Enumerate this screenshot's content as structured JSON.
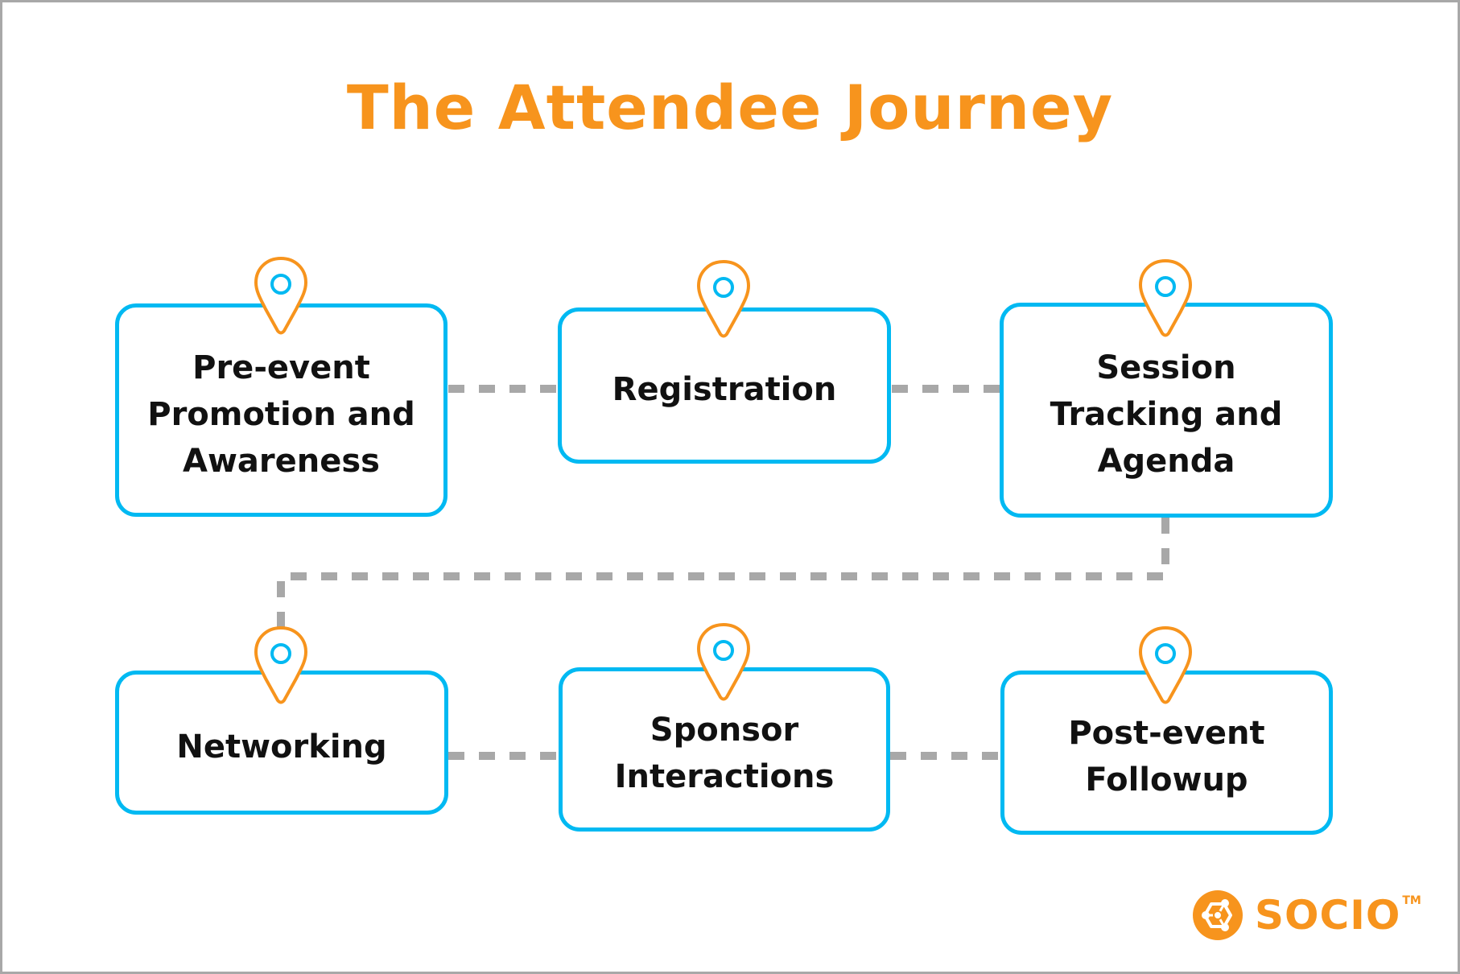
{
  "title": "The Attendee Journey",
  "colors": {
    "accent_orange": "#f7941d",
    "box_border_blue": "#00b9f2",
    "connector_gray": "#a8a8a8",
    "text_dark": "#111111"
  },
  "steps": [
    {
      "label": "Pre-event\nPromotion and\nAwareness",
      "icon": "map-pin-icon"
    },
    {
      "label": "Registration",
      "icon": "map-pin-icon"
    },
    {
      "label": "Session\nTracking and\nAgenda",
      "icon": "map-pin-icon"
    },
    {
      "label": "Networking",
      "icon": "map-pin-icon"
    },
    {
      "label": "Sponsor\nInteractions",
      "icon": "map-pin-icon"
    },
    {
      "label": "Post-event\nFollowup",
      "icon": "map-pin-icon"
    }
  ],
  "flow": [
    {
      "from": 0,
      "to": 1
    },
    {
      "from": 1,
      "to": 2
    },
    {
      "from": 2,
      "to": 3
    },
    {
      "from": 3,
      "to": 4
    },
    {
      "from": 4,
      "to": 5
    }
  ],
  "logo": {
    "icon": "socio-hexagon-logo-icon",
    "text": "SOCIO",
    "trademark": "TM"
  }
}
